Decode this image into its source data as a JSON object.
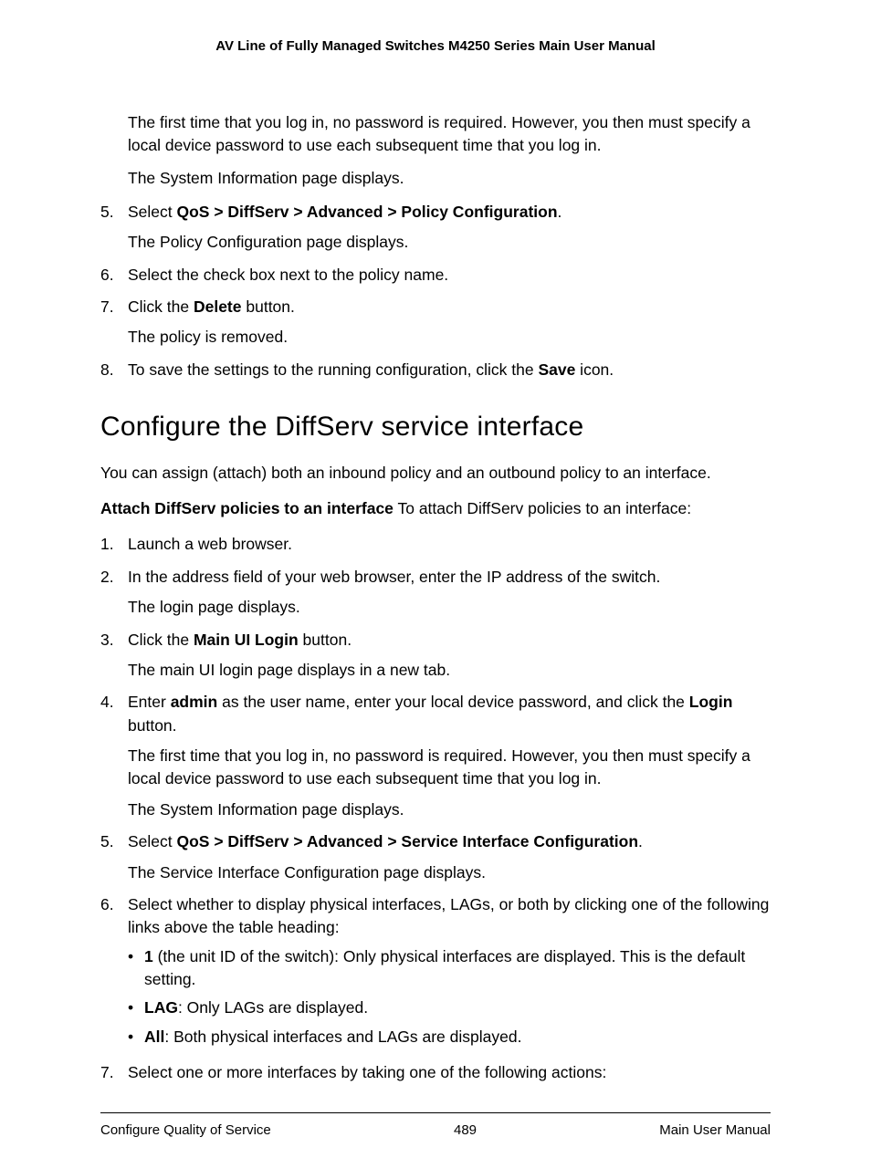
{
  "header": "AV Line of Fully Managed Switches M4250 Series Main User Manual",
  "topIndent1": "The first time that you log in, no password is required. However, you then must specify a local device password to use each subsequent time that you log in.",
  "topIndent2": "The System Information page displays.",
  "stepsA": {
    "s5": {
      "num": "5.",
      "pre": "Select ",
      "bold": "QoS > DiffServ > Advanced > Policy Configuration",
      "post": ".",
      "p2": "The Policy Configuration page displays."
    },
    "s6": {
      "num": "6.",
      "text": "Select the check box next to the policy name."
    },
    "s7": {
      "num": "7.",
      "pre": "Click the ",
      "bold": "Delete",
      "post": " button.",
      "p2": "The policy is removed."
    },
    "s8": {
      "num": "8.",
      "pre": "To save the settings to the running configuration, click the ",
      "bold": "Save",
      "post": " icon."
    }
  },
  "sectionTitle": "Configure the DiffServ service interface",
  "sectionIntro": "You can assign (attach) both an inbound policy and an outbound policy to an interface.",
  "subhead": "Attach DiffServ policies to an interface",
  "subheadTail": " To attach DiffServ policies to an interface:",
  "stepsB": {
    "s1": {
      "num": "1.",
      "text": "Launch a web browser."
    },
    "s2": {
      "num": "2.",
      "p1": "In the address field of your web browser, enter the IP address of the switch.",
      "p2": "The login page displays."
    },
    "s3": {
      "num": "3.",
      "pre": "Click the ",
      "bold": "Main UI Login",
      "post": " button.",
      "p2": "The main UI login page displays in a new tab."
    },
    "s4": {
      "num": "4.",
      "pre1": "Enter ",
      "bold1": "admin",
      "mid": " as the user name, enter your local device password, and click the ",
      "bold2": "Login",
      "post": " button.",
      "p2": "The first time that you log in, no password is required. However, you then must specify a local device password to use each subsequent time that you log in.",
      "p3": "The System Information page displays."
    },
    "s5": {
      "num": "5.",
      "pre": "Select ",
      "bold": "QoS > DiffServ > Advanced > Service Interface Configuration",
      "post": ".",
      "p2": "The Service Interface Configuration page displays."
    },
    "s6": {
      "num": "6.",
      "p1": "Select whether to display physical interfaces, LAGs, or both by clicking one of the following links above the table heading:"
    },
    "s7": {
      "num": "7.",
      "text": "Select one or more interfaces by taking one of the following actions:"
    }
  },
  "bullets": {
    "b1": {
      "bold": "1",
      "text": " (the unit ID of the switch): Only physical interfaces are displayed. This is the default setting."
    },
    "b2": {
      "bold": "LAG",
      "text": ": Only LAGs are displayed."
    },
    "b3": {
      "bold": "All",
      "text": ": Both physical interfaces and LAGs are displayed."
    }
  },
  "footer": {
    "left": "Configure Quality of Service",
    "center": "489",
    "right": "Main User Manual"
  }
}
